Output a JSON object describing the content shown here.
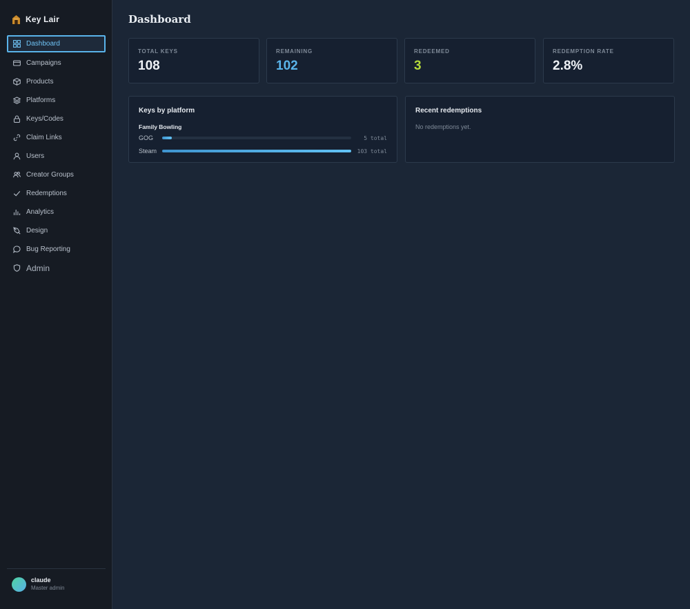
{
  "brand": {
    "name": "Key Lair",
    "logo_icon": "home-icon"
  },
  "sidebar": {
    "items": [
      {
        "label": "Dashboard",
        "icon": "grid-icon",
        "active": true
      },
      {
        "label": "Campaigns",
        "icon": "card-icon"
      },
      {
        "label": "Products",
        "icon": "box-icon"
      },
      {
        "label": "Platforms",
        "icon": "layers-icon"
      },
      {
        "label": "Keys/Codes",
        "icon": "lock-icon"
      },
      {
        "label": "Claim Links",
        "icon": "link-icon"
      },
      {
        "label": "Users",
        "icon": "user-icon"
      },
      {
        "label": "Creator Groups",
        "icon": "users-icon"
      },
      {
        "label": "Redemptions",
        "icon": "check-icon"
      },
      {
        "label": "Analytics",
        "icon": "bar-chart-icon"
      },
      {
        "label": "Design",
        "icon": "pen-icon"
      },
      {
        "label": "Bug Reporting",
        "icon": "chat-icon"
      },
      {
        "label": "Admin",
        "icon": "shield-icon"
      }
    ],
    "footer": {
      "user_name": "claude",
      "user_role": "Master admin"
    }
  },
  "main": {
    "title": "Dashboard",
    "stats": [
      {
        "label": "TOTAL KEYS",
        "value": "108",
        "color": "#eef1f5"
      },
      {
        "label": "REMAINING",
        "value": "102",
        "color": "#5ab4ea"
      },
      {
        "label": "REDEEMED",
        "value": "3",
        "color": "#b4d93a"
      },
      {
        "label": "REDEMPTION RATE",
        "value": "2.8%",
        "color": "#eef1f5"
      }
    ],
    "keys_by_platform": {
      "title": "Keys by platform",
      "group": "Family Bowling",
      "rows": [
        {
          "platform": "GOG",
          "total": "5 total",
          "fraction": 0.05
        },
        {
          "platform": "Steam",
          "total": "103 total",
          "fraction": 1.0
        }
      ]
    },
    "recent_redemptions": {
      "title": "Recent redemptions",
      "empty": "No redemptions yet."
    }
  }
}
